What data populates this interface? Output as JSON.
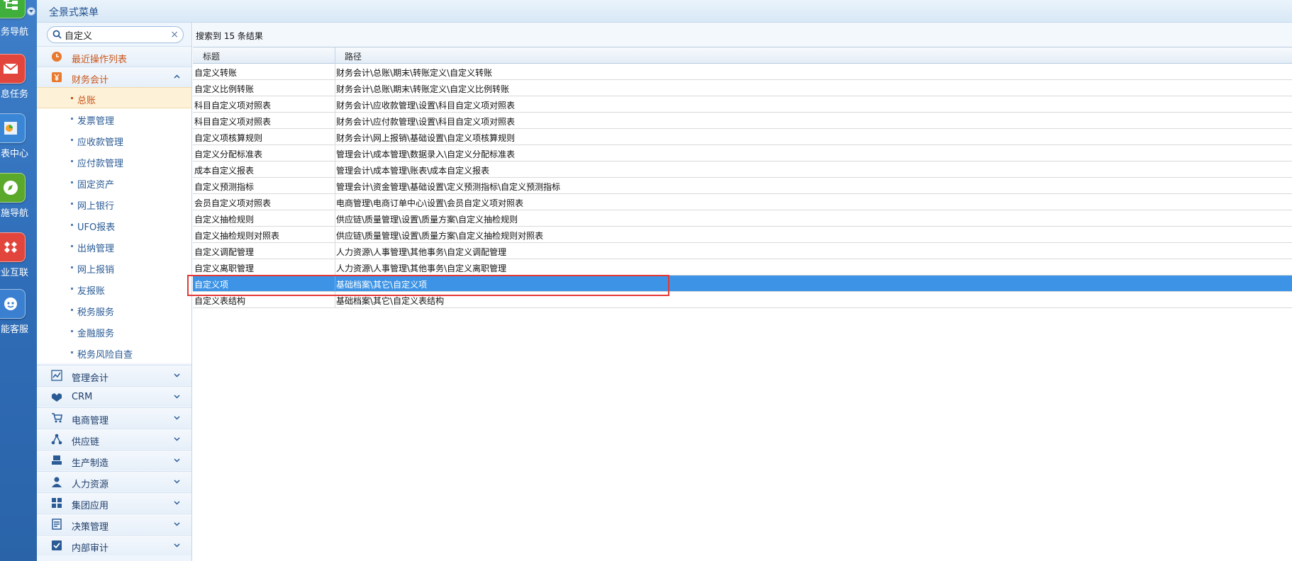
{
  "app_strip": {
    "items": [
      {
        "label": "业务导航",
        "icon": "org-chart-icon",
        "color": "#3fae3a"
      },
      {
        "label": "消息任务",
        "icon": "mail-icon",
        "color": "#e2453c"
      },
      {
        "label": "报表中心",
        "icon": "report-chart-icon",
        "color": "#3a86d6"
      },
      {
        "label": "实施导航",
        "icon": "compass-icon",
        "color": "#5aa92a"
      },
      {
        "label": "企业互联",
        "icon": "diamond-link-icon",
        "color": "#e2453c"
      },
      {
        "label": "智能客服",
        "icon": "robot-icon",
        "color": "#3a7fd0"
      }
    ]
  },
  "header": {
    "title": "全景式菜单"
  },
  "search": {
    "value": "自定义",
    "placeholder": ""
  },
  "menu": {
    "recent": {
      "label": "最近操作列表",
      "icon": "clock-icon"
    },
    "finance": {
      "label": "财务会计",
      "icon": "yen-icon",
      "expanded": true,
      "items": [
        {
          "label": "总账",
          "active": true
        },
        {
          "label": "发票管理"
        },
        {
          "label": "应收款管理"
        },
        {
          "label": "应付款管理"
        },
        {
          "label": "固定资产"
        },
        {
          "label": "网上银行"
        },
        {
          "label": "UFO报表"
        },
        {
          "label": "出纳管理"
        },
        {
          "label": "网上报销"
        },
        {
          "label": "友报账"
        },
        {
          "label": "税务服务"
        },
        {
          "label": "金融服务"
        },
        {
          "label": "税务风险自查"
        }
      ]
    },
    "categories": [
      {
        "label": "管理会计",
        "icon": "line-chart-icon"
      },
      {
        "label": "CRM",
        "icon": "handshake-icon"
      },
      {
        "label": "电商管理",
        "icon": "cart-icon"
      },
      {
        "label": "供应链",
        "icon": "network-icon"
      },
      {
        "label": "生产制造",
        "icon": "factory-icon"
      },
      {
        "label": "人力资源",
        "icon": "person-icon"
      },
      {
        "label": "集团应用",
        "icon": "grid-icon"
      },
      {
        "label": "决策管理",
        "icon": "decision-icon"
      },
      {
        "label": "内部审计",
        "icon": "checklist-icon"
      }
    ]
  },
  "results": {
    "summary": "搜索到 15 条结果",
    "columns": [
      "标题",
      "路径"
    ],
    "rows": [
      {
        "title": "自定义转账",
        "path": "财务会计\\总账\\期末\\转账定义\\自定义转账"
      },
      {
        "title": "自定义比例转账",
        "path": "财务会计\\总账\\期末\\转账定义\\自定义比例转账"
      },
      {
        "title": "科目自定义项对照表",
        "path": "财务会计\\应收款管理\\设置\\科目自定义项对照表"
      },
      {
        "title": "科目自定义项对照表",
        "path": "财务会计\\应付款管理\\设置\\科目自定义项对照表"
      },
      {
        "title": "自定义项核算规则",
        "path": "财务会计\\网上报销\\基础设置\\自定义项核算规则"
      },
      {
        "title": "自定义分配标准表",
        "path": "管理会计\\成本管理\\数据录入\\自定义分配标准表"
      },
      {
        "title": "成本自定义报表",
        "path": "管理会计\\成本管理\\账表\\成本自定义报表"
      },
      {
        "title": "自定义预测指标",
        "path": "管理会计\\资金管理\\基础设置\\定义预测指标\\自定义预测指标"
      },
      {
        "title": "会员自定义项对照表",
        "path": "电商管理\\电商订单中心\\设置\\会员自定义项对照表"
      },
      {
        "title": "自定义抽检规则",
        "path": "供应链\\质量管理\\设置\\质量方案\\自定义抽检规则"
      },
      {
        "title": "自定义抽检规则对照表",
        "path": "供应链\\质量管理\\设置\\质量方案\\自定义抽检规则对照表"
      },
      {
        "title": "自定义调配管理",
        "path": "人力资源\\人事管理\\其他事务\\自定义调配管理"
      },
      {
        "title": "自定义离职管理",
        "path": "人力资源\\人事管理\\其他事务\\自定义离职管理"
      },
      {
        "title": "自定义项",
        "path": "基础档案\\其它\\自定义项",
        "selected": true
      },
      {
        "title": "自定义表结构",
        "path": "基础档案\\其它\\自定义表结构"
      }
    ]
  },
  "colors": {
    "accent": "#3d94e6",
    "active_menu": "#c8561a",
    "highlight_box": "#e53935"
  }
}
